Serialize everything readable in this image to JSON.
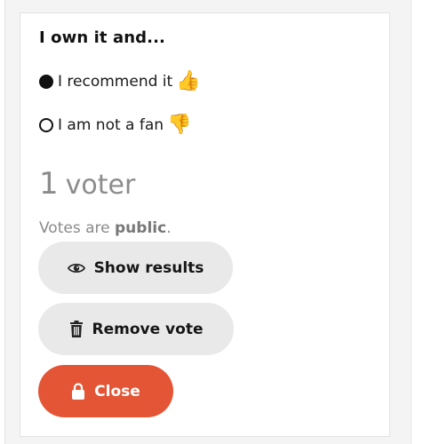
{
  "poll": {
    "title": "I own it and...",
    "options": [
      {
        "label": "I recommend it",
        "emoji": "👍",
        "selected": true
      },
      {
        "label": "I am not a fan",
        "emoji": "👎",
        "selected": false
      }
    ],
    "voter_number": "1",
    "voter_word": "voter",
    "visibility_prefix": "Votes are ",
    "visibility_value": "public",
    "visibility_suffix": "."
  },
  "actions": {
    "show_results": {
      "label": "Show results",
      "icon": "eye-icon"
    },
    "remove_vote": {
      "label": "Remove vote",
      "icon": "trash-icon"
    },
    "close": {
      "label": "Close",
      "icon": "lock-icon"
    }
  },
  "colors": {
    "close_button": "#e35535",
    "secondary_button": "#e9e9e9",
    "muted_text": "#8c8c8c"
  }
}
